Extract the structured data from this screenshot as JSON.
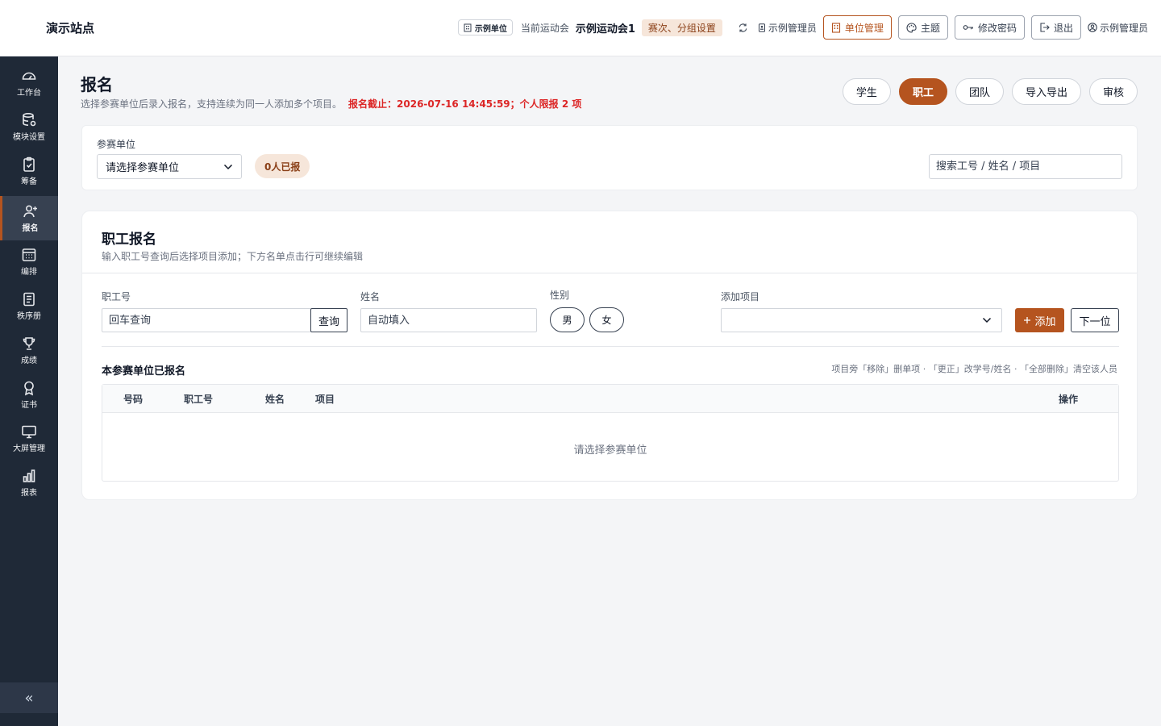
{
  "header": {
    "site_title": "演示站点",
    "unit_tag": "示例单位",
    "current_label": "当前运动会",
    "current_meet": "示例运动会1",
    "round_setting": "赛次、分组设置",
    "admin_chip": "示例管理员",
    "unit_manage": "单位管理",
    "theme": "主题",
    "change_password": "修改密码",
    "logout": "退出",
    "user": "示例管理员"
  },
  "sidebar": {
    "items": [
      {
        "label": "工作台",
        "icon": "dashboard-icon"
      },
      {
        "label": "模块设置",
        "icon": "database-gear-icon"
      },
      {
        "label": "筹备",
        "icon": "clipboard-icon"
      },
      {
        "label": "报名",
        "icon": "user-add-icon"
      },
      {
        "label": "编排",
        "icon": "calendar-grid-icon"
      },
      {
        "label": "秩序册",
        "icon": "list-document-icon"
      },
      {
        "label": "成绩",
        "icon": "trophy-icon"
      },
      {
        "label": "证书",
        "icon": "award-icon"
      },
      {
        "label": "大屏管理",
        "icon": "monitor-icon"
      },
      {
        "label": "报表",
        "icon": "bar-chart-icon"
      }
    ],
    "active_index": 3,
    "collapse_icon": "double-chevron-left-icon"
  },
  "page": {
    "title": "报名",
    "subtitle": "选择参赛单位后录入报名，支持连续为同一人添加多个项目。",
    "deadline": "报名截止：2026-07-16 14:45:59；个人限报 2 项",
    "tabs": [
      "学生",
      "职工",
      "团队",
      "导入导出",
      "审核"
    ],
    "active_tab": "职工"
  },
  "filter": {
    "unit_label": "参赛单位",
    "unit_select": "请选择参赛单位",
    "count_badge": "0人已报",
    "search_placeholder": "搜索工号 / 姓名 / 项目"
  },
  "form": {
    "title": "职工报名",
    "subtitle": "输入职工号查询后选择项目添加；下方名单点击行可继续编辑",
    "staff_id_label": "职工号",
    "staff_id_placeholder": "回车查询",
    "query_btn": "查询",
    "name_label": "姓名",
    "name_placeholder": "自动填入",
    "gender_label": "性别",
    "gender_male": "男",
    "gender_female": "女",
    "project_label": "添加项目",
    "project_value": "",
    "add_btn": "添加",
    "next_btn": "下一位"
  },
  "list": {
    "title": "本参赛单位已报名",
    "hint": "项目旁「移除」删单项 · 「更正」改学号/姓名 · 「全部删除」清空该人员",
    "columns": [
      "号码",
      "职工号",
      "姓名",
      "项目",
      "操作"
    ],
    "empty_text": "请选择参赛单位"
  },
  "colors": {
    "accent": "#b5541f",
    "sidebar_bg": "#1f2937",
    "warning": "#dc2626"
  }
}
